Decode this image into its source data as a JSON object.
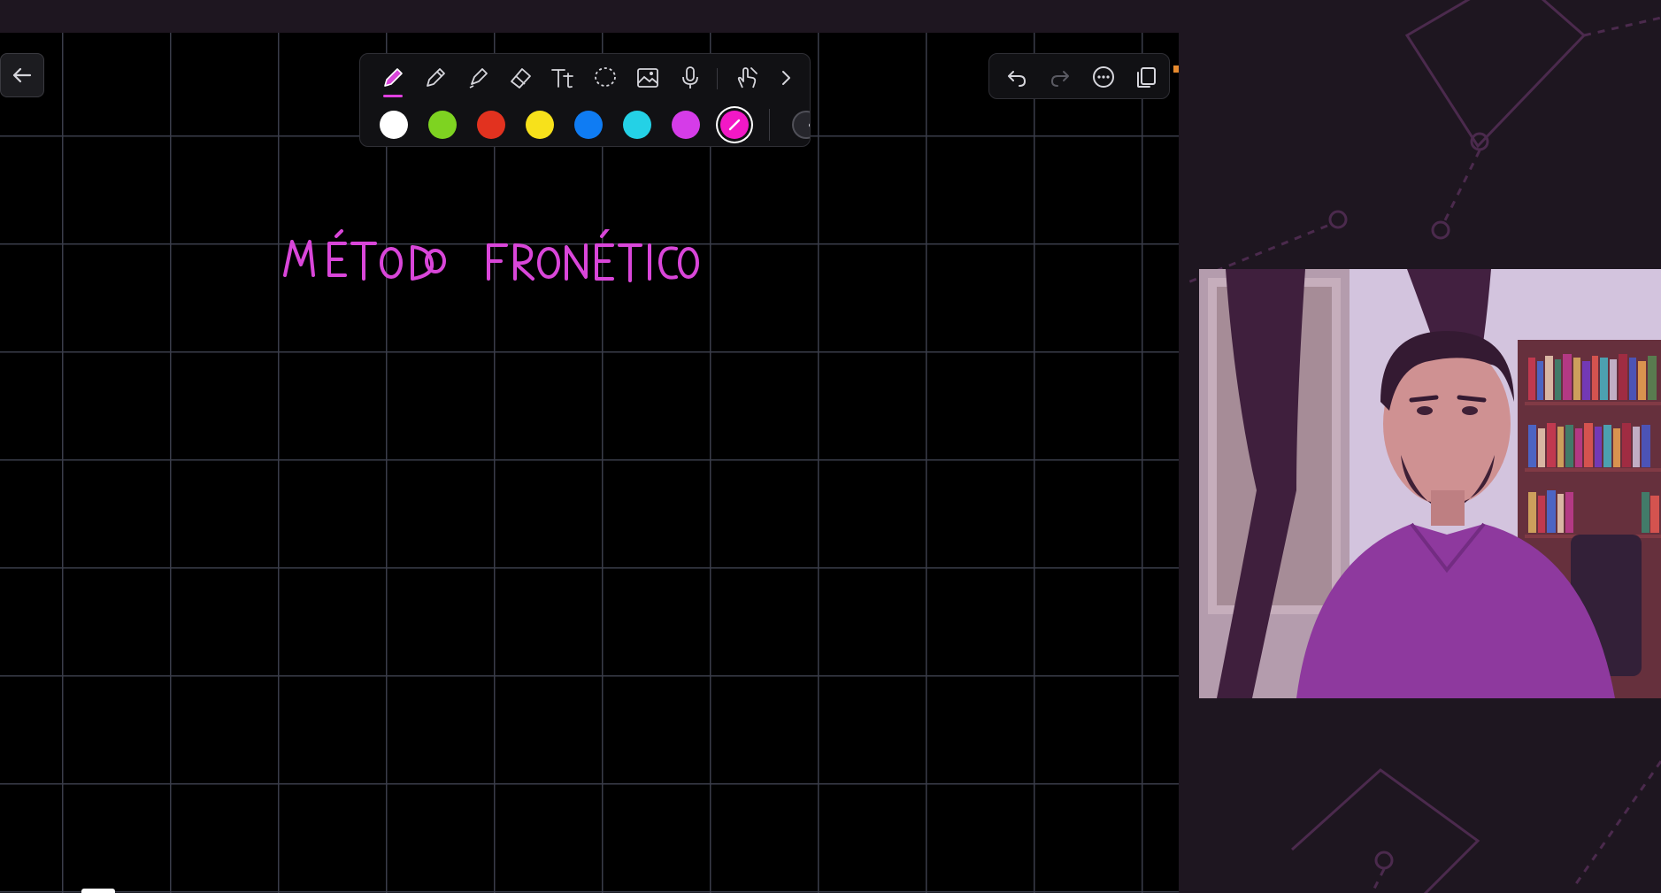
{
  "canvas": {
    "handwritten_title": "MÉTODO FRONÉTICO",
    "grid_color": "#3a3d4a",
    "background_color": "#000000",
    "ink_color": "#d946d9"
  },
  "toolbar": {
    "tools": [
      {
        "name": "pen",
        "icon": "pen-icon",
        "active": true
      },
      {
        "name": "pencil",
        "icon": "pencil-icon",
        "active": false
      },
      {
        "name": "highlighter",
        "icon": "highlighter-icon",
        "active": false
      },
      {
        "name": "eraser",
        "icon": "eraser-icon",
        "active": false
      },
      {
        "name": "text",
        "icon": "text-tool-icon",
        "label": "Tt",
        "active": false
      },
      {
        "name": "lasso",
        "icon": "lasso-icon",
        "active": false
      },
      {
        "name": "image",
        "icon": "image-icon",
        "active": false
      },
      {
        "name": "audio",
        "icon": "microphone-icon",
        "active": false
      },
      {
        "name": "touch",
        "icon": "hand-touch-icon",
        "active": false
      },
      {
        "name": "more",
        "icon": "chevron-right-icon",
        "active": false
      }
    ],
    "text_tool_label": "Tt",
    "colors": [
      {
        "name": "white",
        "hex": "#ffffff",
        "selected": false
      },
      {
        "name": "green",
        "hex": "#7ed321",
        "selected": false
      },
      {
        "name": "red",
        "hex": "#e2321f",
        "selected": false
      },
      {
        "name": "yellow",
        "hex": "#f7e11b",
        "selected": false
      },
      {
        "name": "blue",
        "hex": "#0f7cf3",
        "selected": false
      },
      {
        "name": "cyan",
        "hex": "#24d1e6",
        "selected": false
      },
      {
        "name": "purple",
        "hex": "#d53ce8",
        "selected": false
      },
      {
        "name": "magenta",
        "hex": "#f218c6",
        "selected": true
      }
    ]
  },
  "right_toolbar": {
    "buttons": [
      {
        "name": "undo",
        "icon": "undo-icon",
        "enabled": true
      },
      {
        "name": "redo",
        "icon": "redo-icon",
        "enabled": false
      },
      {
        "name": "more-options",
        "icon": "more-horizontal-icon",
        "enabled": true
      },
      {
        "name": "pages",
        "icon": "copy-pages-icon",
        "enabled": true
      }
    ]
  },
  "navigation": {
    "back_icon": "arrow-left-icon"
  },
  "webcam": {
    "description_icon": "webcam-feed"
  }
}
